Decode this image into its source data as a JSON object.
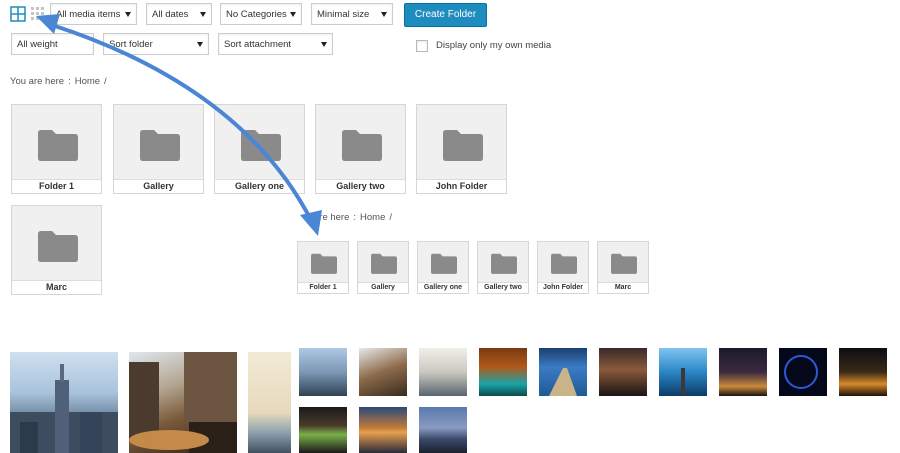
{
  "toolbar": {
    "grid_view_icon": "grid-large-icon",
    "list_view_icon": "grid-small-icon",
    "filter_media": "All media items",
    "filter_dates": "All dates",
    "filter_categories": "No Categories",
    "filter_size": "Minimal size",
    "create_folder_label": "Create Folder",
    "filter_weight": "All weight",
    "sort_folder": "Sort folder",
    "sort_attachment": "Sort attachment",
    "own_media_label": "Display only my own media",
    "own_media_checked": false
  },
  "breadcrumb": {
    "prefix": "You are here",
    "separator": ":",
    "home": "Home",
    "trail": "/"
  },
  "breadcrumb_small": {
    "prefix": "are here",
    "separator": ":",
    "home": "Home",
    "trail": "/"
  },
  "folders": [
    {
      "name": "Folder 1"
    },
    {
      "name": "Gallery"
    },
    {
      "name": "Gallery one"
    },
    {
      "name": "Gallery two"
    },
    {
      "name": "John Folder"
    },
    {
      "name": "Marc"
    }
  ],
  "folders_small": [
    {
      "name": "Folder 1"
    },
    {
      "name": "Gallery"
    },
    {
      "name": "Gallery one"
    },
    {
      "name": "Gallery two"
    },
    {
      "name": "John Folder"
    },
    {
      "name": "Marc"
    }
  ],
  "colors": {
    "accent": "#1e8cbe",
    "arrow": "#4a86d4",
    "folder_icon": "#8a8a8a",
    "folder_bg": "#f0f0f0"
  }
}
